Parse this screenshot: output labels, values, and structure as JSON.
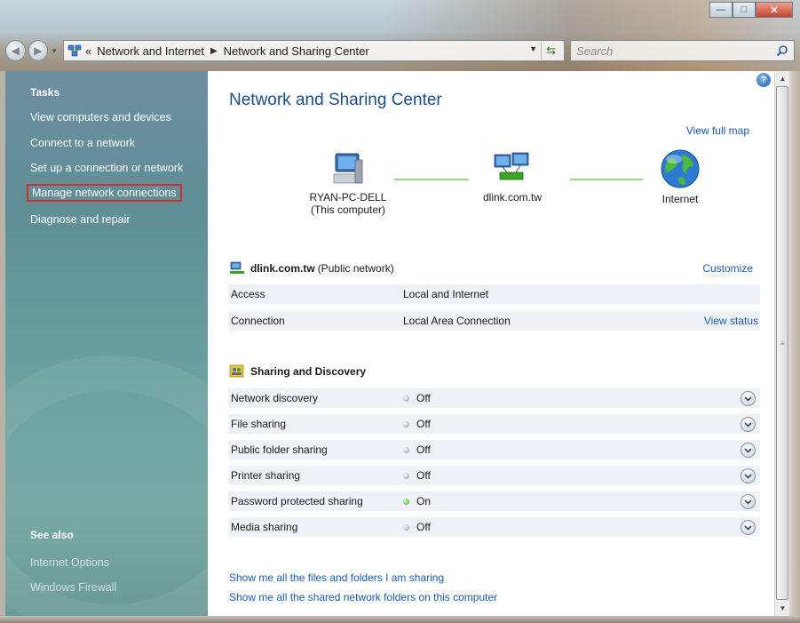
{
  "window": {
    "controls": [
      "minimize",
      "maximize",
      "close"
    ]
  },
  "navbar": {
    "breadcrumb": {
      "overflow": "«",
      "items": [
        "Network and Internet",
        "Network and Sharing Center"
      ]
    },
    "search_placeholder": "Search"
  },
  "sidebar": {
    "tasks_heading": "Tasks",
    "tasks": [
      "View computers and devices",
      "Connect to a network",
      "Set up a connection or network",
      "Manage network connections",
      "Diagnose and repair"
    ],
    "see_also_heading": "See also",
    "see_also": [
      "Internet Options",
      "Windows Firewall"
    ]
  },
  "main": {
    "title": "Network and Sharing Center",
    "view_full_map": "View full map",
    "map": {
      "computer_line1": "RYAN-PC-DELL",
      "computer_line2": "(This computer)",
      "network": "dlink.com.tw",
      "internet": "Internet"
    },
    "network_section": {
      "name": "dlink.com.tw",
      "type": "(Public network)",
      "customize": "Customize",
      "rows": [
        {
          "label": "Access",
          "value": "Local and Internet",
          "link": ""
        },
        {
          "label": "Connection",
          "value": "Local Area Connection",
          "link": "View status"
        }
      ]
    },
    "sharing_section": {
      "heading": "Sharing and Discovery",
      "rows": [
        {
          "label": "Network discovery",
          "status": "Off"
        },
        {
          "label": "File sharing",
          "status": "Off"
        },
        {
          "label": "Public folder sharing",
          "status": "Off"
        },
        {
          "label": "Printer sharing",
          "status": "Off"
        },
        {
          "label": "Password protected sharing",
          "status": "On"
        },
        {
          "label": "Media sharing",
          "status": "Off"
        }
      ]
    },
    "footer_links": [
      "Show me all the files and folders I am sharing",
      "Show me all the shared network folders on this computer"
    ]
  },
  "colors": {
    "link": "#1e5aa8",
    "title": "#1e4d84",
    "status_on": "#3aa323",
    "status_off": "#8a9299",
    "highlight_box": "#d0312d"
  }
}
